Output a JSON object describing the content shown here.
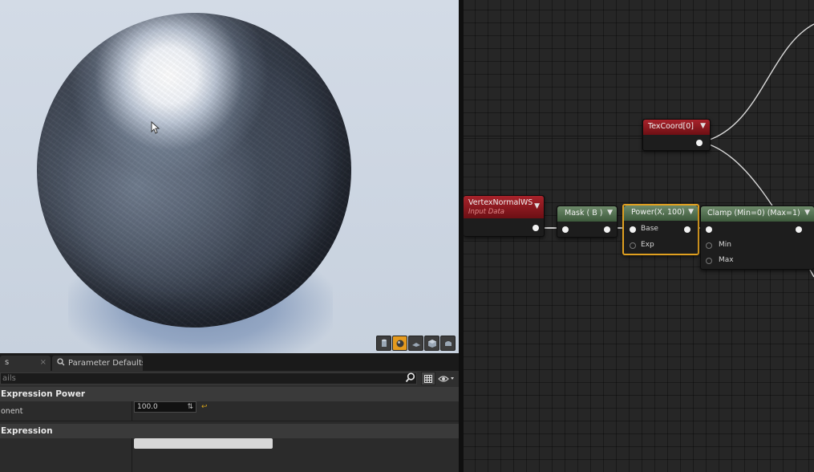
{
  "viewport": {
    "toolbar_icons": [
      "cylinder-icon",
      "sphere-icon",
      "plane-icon",
      "cube-icon",
      "custom-mesh-icon"
    ],
    "active_icon": "sphere-icon"
  },
  "details": {
    "tabs": [
      {
        "label": "s",
        "close": "×"
      },
      {
        "label": "Parameter Defaults",
        "close": "×"
      }
    ],
    "search_placeholder": "ails",
    "categories": {
      "power": "Expression Power",
      "expression": "Expression"
    },
    "properties": [
      {
        "label": "onent",
        "value": "100.0"
      }
    ],
    "reset_glyph": "↩",
    "spin_glyph": "⇅"
  },
  "graph": {
    "nodes": {
      "texcoord": {
        "title": "TexCoord[0]"
      },
      "vertexnormal": {
        "title": "VertexNormalWS",
        "subtitle": "Input Data"
      },
      "mask": {
        "title": "Mask ( B )"
      },
      "power": {
        "title": "Power(X, 100)",
        "pins": [
          "Base",
          "Exp"
        ]
      },
      "clamp": {
        "title": "Clamp (Min=0) (Max=1)",
        "pins": [
          "Min",
          "Max"
        ]
      }
    },
    "dropdown_glyph": "▼",
    "colors": {
      "selection": "#e0a020",
      "function_header": "#4f6d4d",
      "parameter_header": "#8a1a20"
    }
  }
}
